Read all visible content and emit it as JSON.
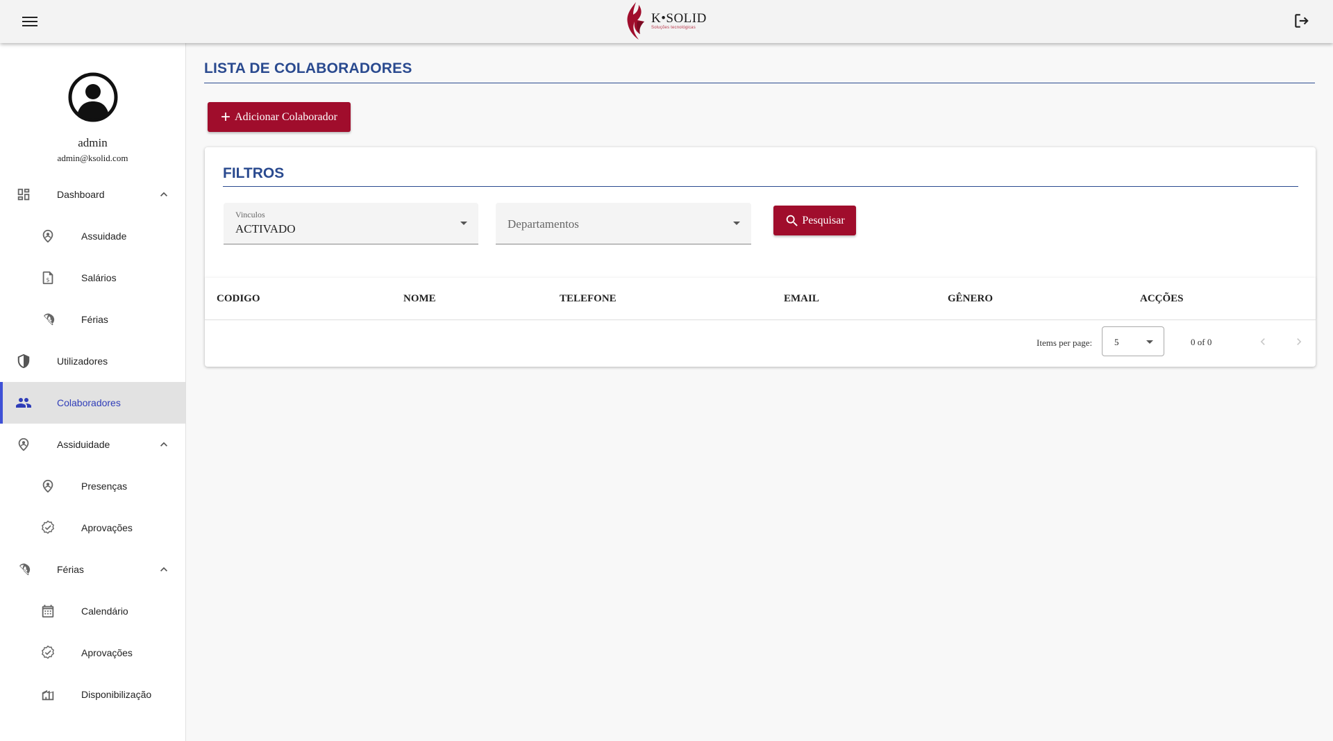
{
  "header": {
    "logo_name": "K•SOLID",
    "logo_tagline": "Soluções tecnológicas",
    "menu_icon": "menu-icon",
    "logout_icon": "logout-icon"
  },
  "colors": {
    "primary": "#a00d2c",
    "heading": "#2a4a8f",
    "active_indicator": "#3f51d6"
  },
  "profile": {
    "name": "admin",
    "email": "admin@ksolid.com"
  },
  "sidebar": {
    "items": [
      {
        "label": "Dashboard",
        "icon": "dashboard-icon",
        "expanded": true
      },
      {
        "label": "Assuidade",
        "icon": "location-pin-icon"
      },
      {
        "label": "Salários",
        "icon": "money-document-icon"
      },
      {
        "label": "Férias",
        "icon": "beach-umbrella-icon"
      },
      {
        "label": "Utilizadores",
        "icon": "shield-icon"
      },
      {
        "label": "Colaboradores",
        "icon": "people-icon",
        "active": true
      },
      {
        "label": "Assiduidade",
        "icon": "location-pin-icon",
        "expanded": true
      },
      {
        "label": "Presenças",
        "icon": "location-pin-icon"
      },
      {
        "label": "Aprovações",
        "icon": "verified-badge-icon"
      },
      {
        "label": "Férias",
        "icon": "beach-umbrella-icon",
        "expanded": true
      },
      {
        "label": "Calendário",
        "icon": "calendar-icon"
      },
      {
        "label": "Aprovações",
        "icon": "verified-badge-icon"
      },
      {
        "label": "Disponibilização",
        "icon": "building-icon"
      }
    ]
  },
  "main": {
    "title": "LISTA DE COLABORADORES",
    "add_button": "Adicionar Colaborador",
    "filters": {
      "title": "FILTROS",
      "vinculos_label": "Vinculos",
      "vinculos_value": "ACTIVADO",
      "departamentos_placeholder": "Departamentos",
      "search_button": "Pesquisar"
    },
    "table": {
      "columns": [
        "CODIGO",
        "NOME",
        "TELEFONE",
        "EMAIL",
        "GÊNERO",
        "ACÇÕES"
      ],
      "rows": []
    },
    "paginator": {
      "items_per_page_label": "Items per page:",
      "items_per_page": "5",
      "range": "0 of 0"
    }
  }
}
